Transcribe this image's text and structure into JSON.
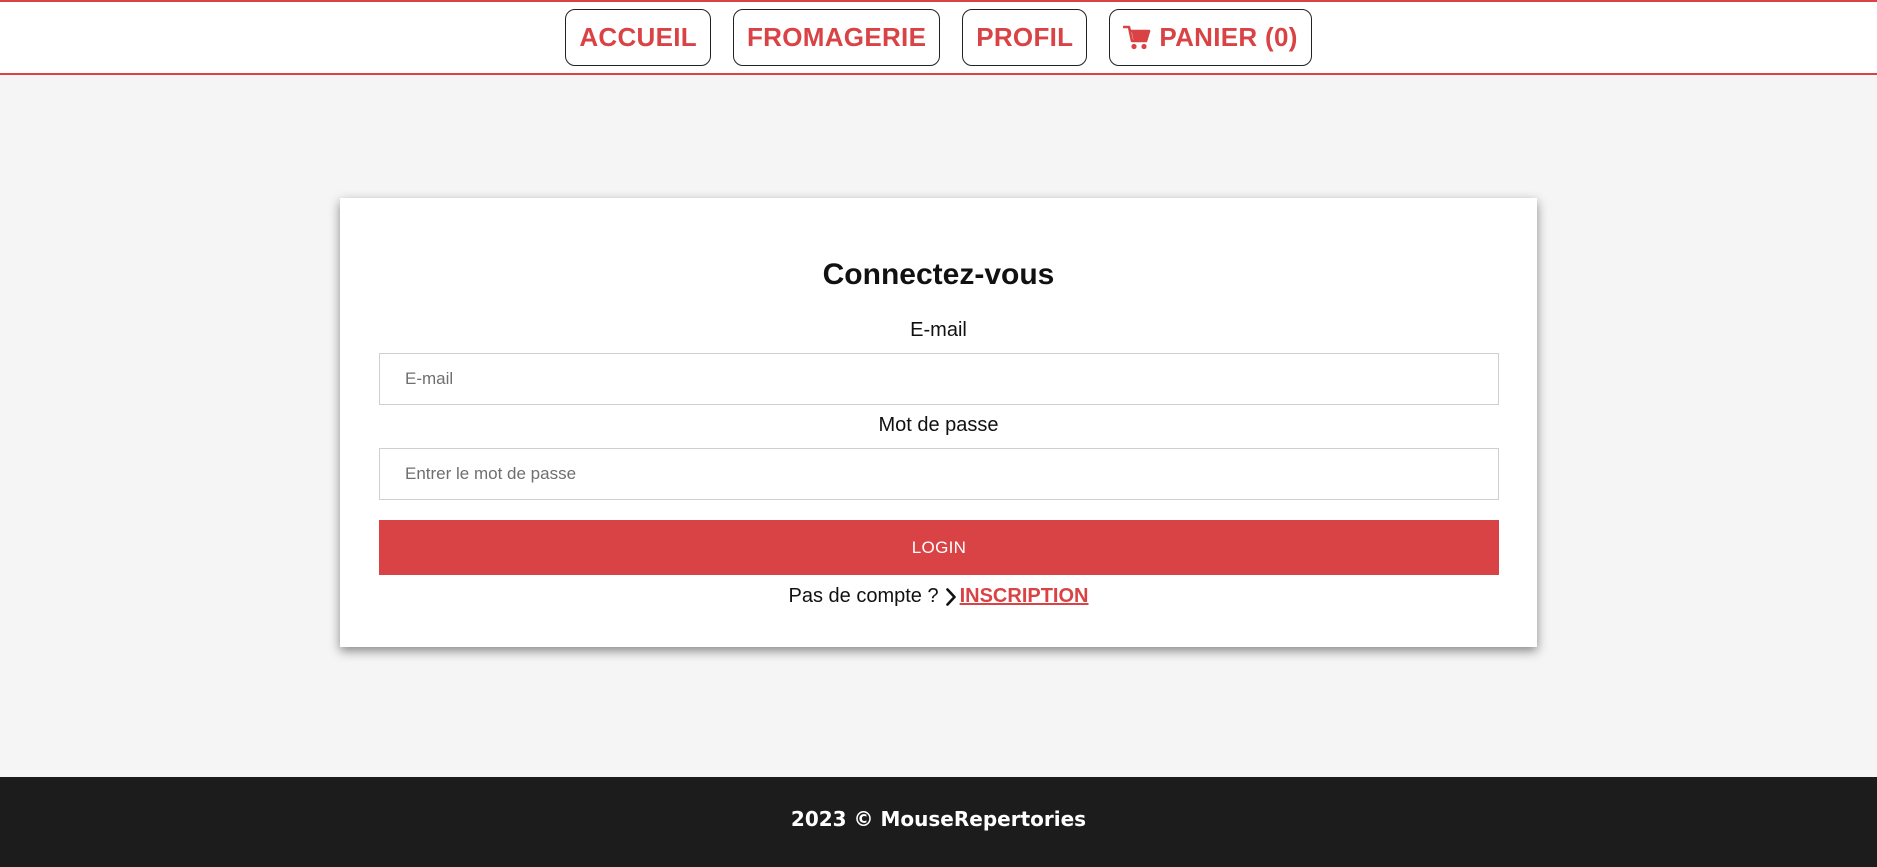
{
  "nav": {
    "items": [
      {
        "label": "ACCUEIL"
      },
      {
        "label": "FROMAGERIE"
      },
      {
        "label": "PROFIL"
      },
      {
        "label": "PANIER (0)",
        "icon": "cart-icon"
      }
    ]
  },
  "login": {
    "title": "Connectez-vous",
    "email_label": "E-mail",
    "email_placeholder": "E-mail",
    "password_label": "Mot de passe",
    "password_placeholder": "Entrer le mot de passe",
    "submit_label": "LOGIN",
    "no_account_text": "Pas de compte ?",
    "signup_icon": "chevron-right-icon",
    "signup_label": "INSCRIPTION"
  },
  "footer": {
    "text": "2023 © MouseRepertories"
  },
  "colors": {
    "accent": "#d94345",
    "background": "#f4f5f4",
    "footer_bg": "#1c1c1c"
  }
}
